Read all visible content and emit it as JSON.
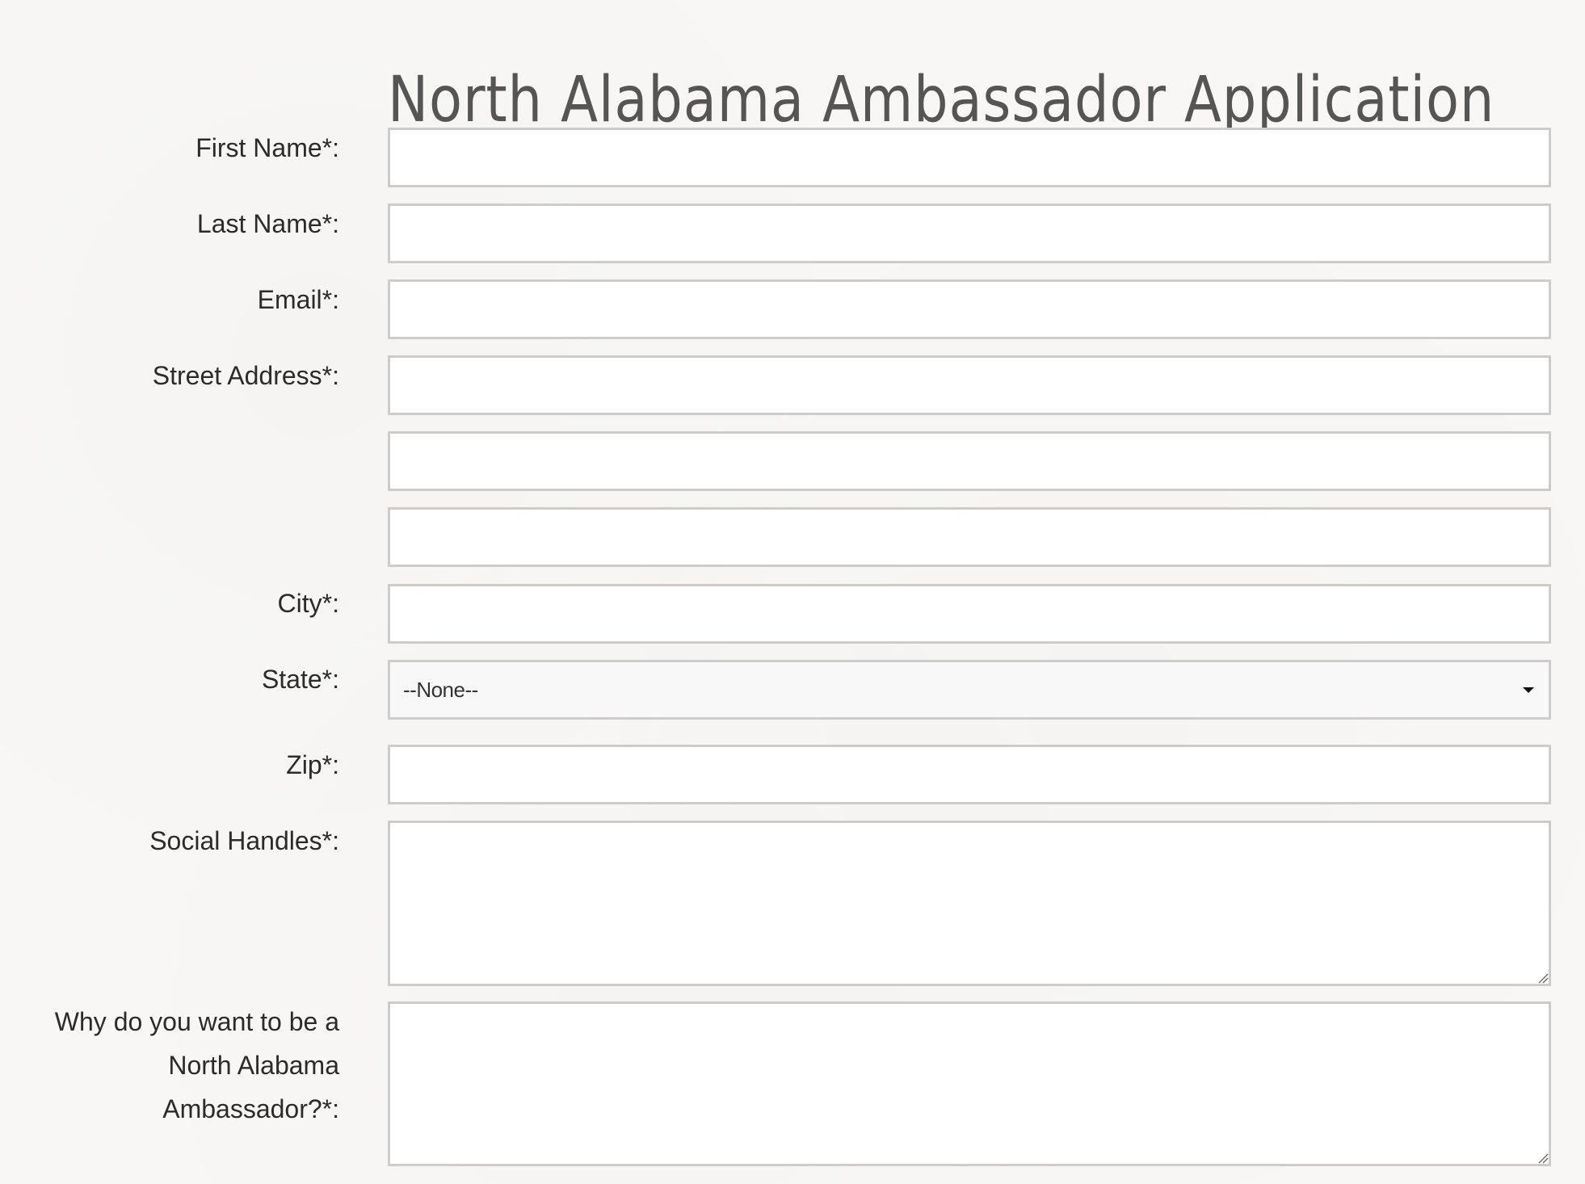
{
  "page": {
    "title": "North Alabama Ambassador Application"
  },
  "form": {
    "first_name": {
      "label": "First Name*:",
      "value": "",
      "placeholder": ""
    },
    "last_name": {
      "label": "Last Name*:",
      "value": "",
      "placeholder": ""
    },
    "email": {
      "label": "Email*:",
      "value": "",
      "placeholder": ""
    },
    "street_address": {
      "label": "Street Address*:",
      "line1": "",
      "line2": "",
      "line3": ""
    },
    "city": {
      "label": "City*:",
      "value": "",
      "placeholder": ""
    },
    "state": {
      "label": "State*:",
      "selected": "--None--"
    },
    "zip": {
      "label": "Zip*:",
      "value": "",
      "placeholder": ""
    },
    "social_handles": {
      "label": "Social Handles*:",
      "value": ""
    },
    "why": {
      "label_line1": "Why do you want to be a",
      "label_line2": "North Alabama",
      "label_line3": "Ambassador?*:",
      "value": ""
    }
  },
  "icons": {
    "select_caret": "chevron-down-icon",
    "resize_grip": "resize-grip-icon"
  },
  "colors": {
    "background": "#f8f7f5",
    "title": "#555555",
    "label": "#2b2b2b",
    "field_border": "#cccccc",
    "select_bg": "#f8f8f8"
  }
}
